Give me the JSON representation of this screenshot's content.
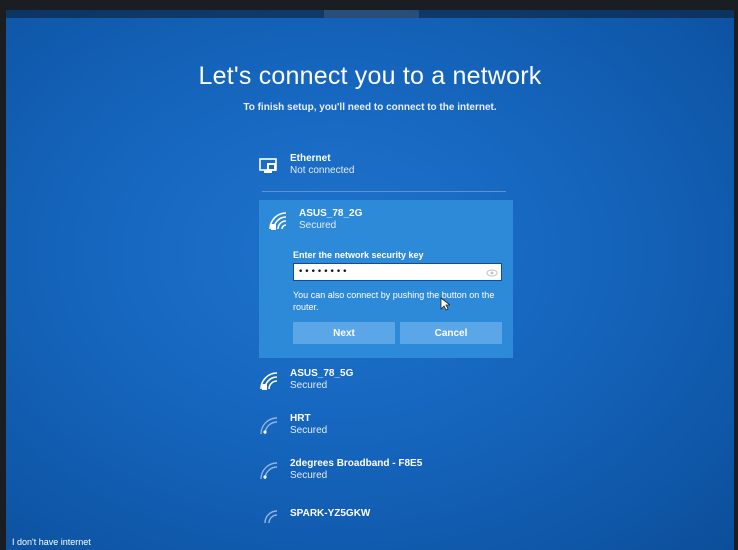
{
  "title": "Let's connect you to a network",
  "subtitle": "To finish setup, you'll need to connect to the internet.",
  "ethernet": {
    "name": "Ethernet",
    "status": "Not connected",
    "icon": "ethernet-icon"
  },
  "selected_network": {
    "name": "ASUS_78_2G",
    "status": "Secured",
    "icon": "wifi-icon",
    "key_label": "Enter the network security key",
    "key_value": "••••••••",
    "hint": "You can also connect by pushing the button on the router.",
    "next_label": "Next",
    "cancel_label": "Cancel"
  },
  "networks": [
    {
      "name": "ASUS_78_5G",
      "status": "Secured",
      "icon": "wifi-icon"
    },
    {
      "name": "HRT",
      "status": "Secured",
      "icon": "wifi-weak-icon"
    },
    {
      "name": "2degrees Broadband - F8E5",
      "status": "Secured",
      "icon": "wifi-weak-icon"
    },
    {
      "name": "SPARK-YZ5GKW",
      "status": "",
      "icon": "wifi-weak-icon"
    }
  ],
  "footer": {
    "no_internet_label": "I don't have internet"
  },
  "colors": {
    "background": "#1565bd",
    "selected_card": "#2c8ad8",
    "button": "#5ba6e6"
  }
}
